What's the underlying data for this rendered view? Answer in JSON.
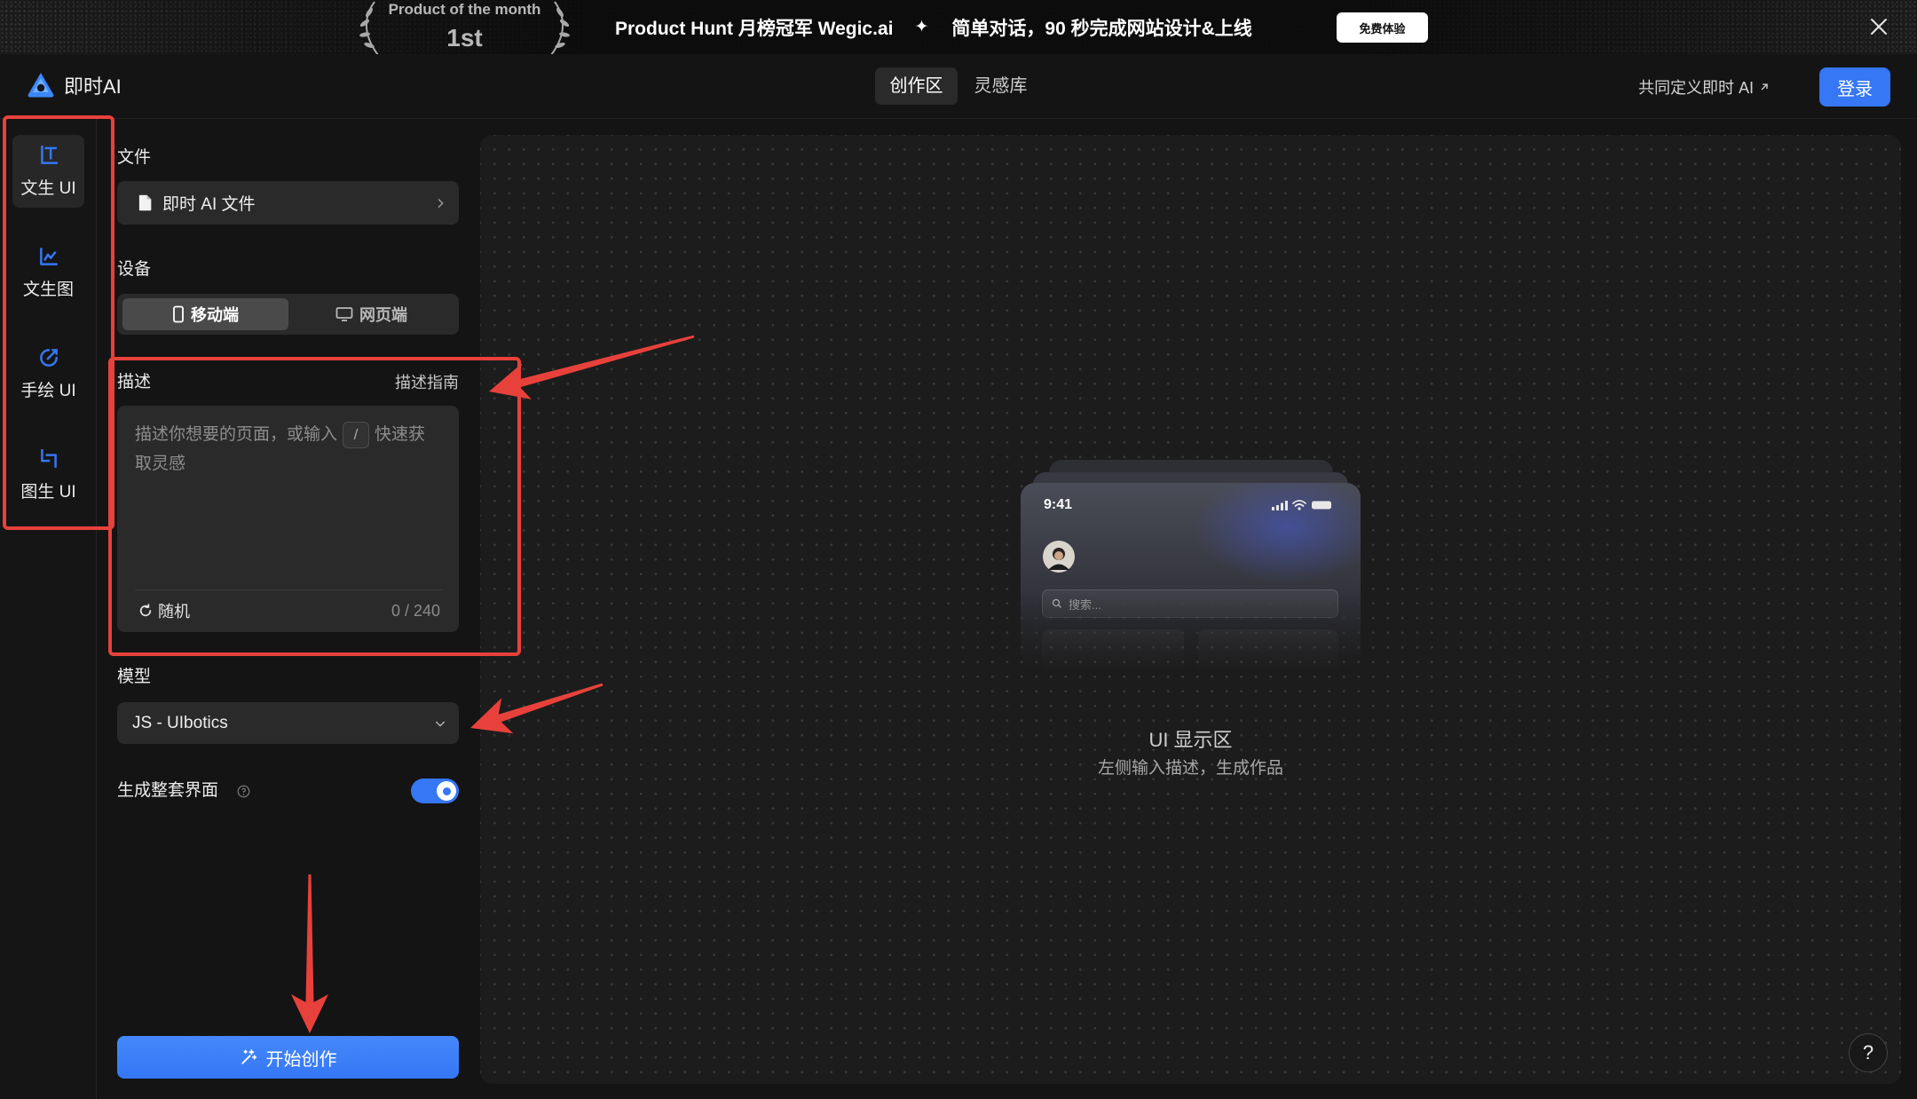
{
  "banner": {
    "badge_top": "Product of the month",
    "badge_rank": "1st",
    "headline": "Product Hunt 月榜冠军 Wegic.ai",
    "separator": "✦",
    "tagline": "简单对话，90 秒完成网站设计&上线",
    "cta_label": "免费体验",
    "close_icon": "close-icon"
  },
  "header": {
    "logo_icon": "jishi-ai-logo-icon",
    "app_name": "即时AI",
    "tabs": [
      {
        "label": "创作区",
        "active": true
      },
      {
        "label": "灵感库",
        "active": false
      }
    ],
    "community_link": "共同定义即时 AI",
    "community_link_icon": "arrow-up-right-icon",
    "login_label": "登录"
  },
  "sidebar": {
    "items": [
      {
        "label": "文生 UI",
        "icon": "text-to-ui-icon",
        "active": true
      },
      {
        "label": "文生图",
        "icon": "text-to-image-icon",
        "active": false
      },
      {
        "label": "手绘 UI",
        "icon": "sketch-to-ui-icon",
        "active": false
      },
      {
        "label": "图生 UI",
        "icon": "image-to-ui-icon",
        "active": false
      }
    ]
  },
  "panel": {
    "file": {
      "label": "文件",
      "value": "即时 AI 文件",
      "icon": "file-icon",
      "action_icon": "chevron-right-icon"
    },
    "device": {
      "label": "设备",
      "options": [
        {
          "label": "移动端",
          "icon": "mobile-icon",
          "active": true
        },
        {
          "label": "网页端",
          "icon": "monitor-icon",
          "active": false
        }
      ]
    },
    "description": {
      "label": "描述",
      "guide_link": "描述指南",
      "value": "",
      "placeholder_before": "描述你想要的页面，或输入",
      "placeholder_key": "/",
      "placeholder_after": "快速获取灵感",
      "random_label": "随机",
      "random_icon": "refresh-icon",
      "counter": "0 / 240"
    },
    "model": {
      "label": "模型",
      "value": "JS - UIbotics",
      "icon": "chevron-down-icon"
    },
    "full_set": {
      "label": "生成整套界面",
      "help_icon": "question-circle-icon",
      "enabled": true
    },
    "start": {
      "label": "开始创作",
      "icon": "magic-wand-icon"
    }
  },
  "canvas": {
    "preview": {
      "time": "9:41",
      "search_placeholder": "搜索..."
    },
    "title": "UI 显示区",
    "subtitle": "左侧输入描述，生成作品",
    "help_label": "?"
  },
  "colors": {
    "accent": "#3577f4",
    "annotation": "#e8413b",
    "canvas_bg": "#1c1c1c",
    "page_bg": "#141414"
  }
}
